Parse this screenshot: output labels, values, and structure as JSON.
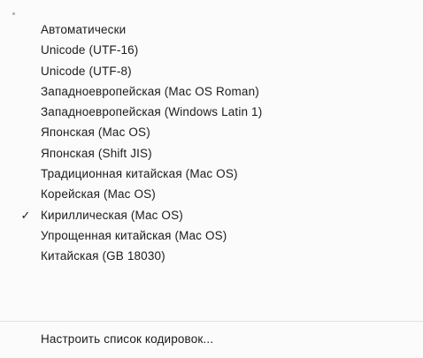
{
  "menu": {
    "items": [
      {
        "label": "Автоматически",
        "checked": false
      },
      {
        "label": "Unicode (UTF-16)",
        "checked": false
      },
      {
        "label": "Unicode (UTF-8)",
        "checked": false
      },
      {
        "label": "Западноевропейская (Mac OS Roman)",
        "checked": false
      },
      {
        "label": "Западноевропейская (Windows Latin 1)",
        "checked": false
      },
      {
        "label": "Японская (Mac OS)",
        "checked": false
      },
      {
        "label": "Японская (Shift JIS)",
        "checked": false
      },
      {
        "label": "Традиционная китайская (Mac OS)",
        "checked": false
      },
      {
        "label": "Корейская (Mac OS)",
        "checked": false
      },
      {
        "label": "Кириллическая (Mac OS)",
        "checked": true
      },
      {
        "label": "Упрощенная китайская (Mac OS)",
        "checked": false
      },
      {
        "label": "Китайская (GB 18030)",
        "checked": false
      }
    ],
    "checkmark": "✓",
    "footer_label": "Настроить список кодировок..."
  }
}
